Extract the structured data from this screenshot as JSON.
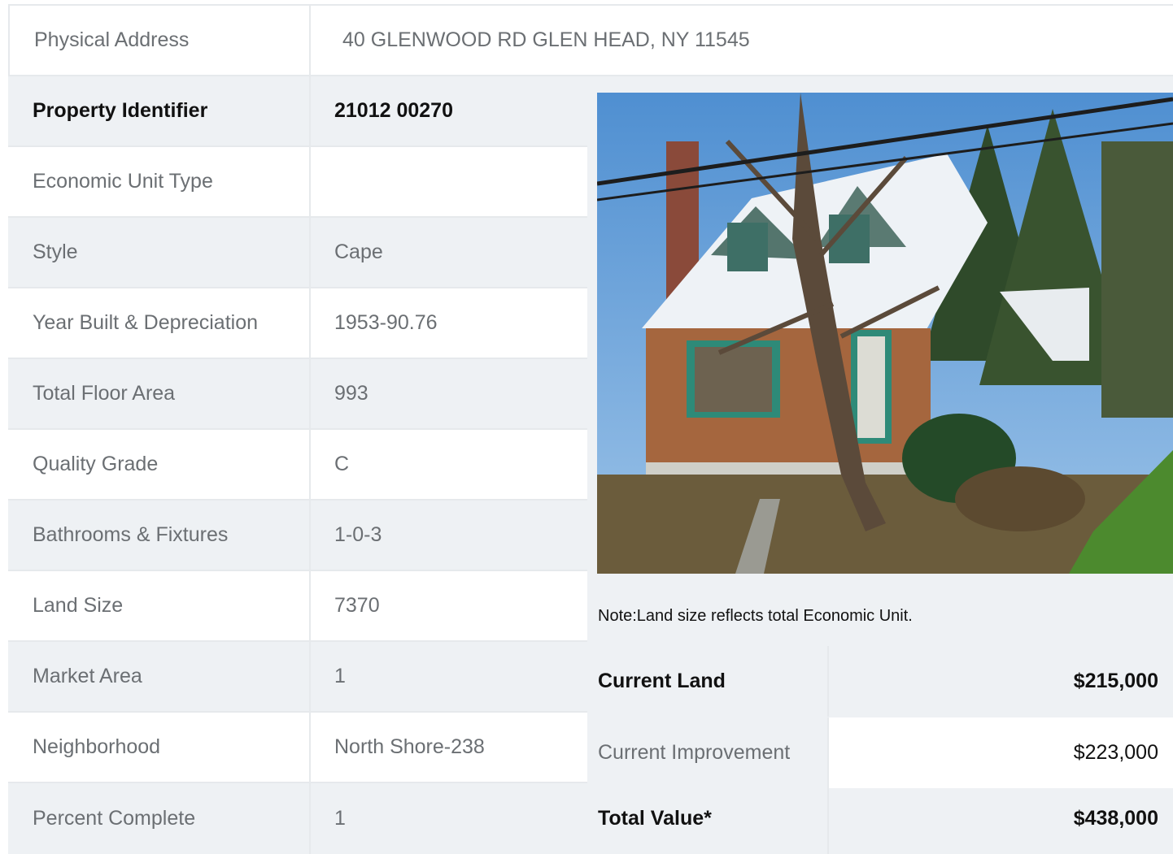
{
  "address": {
    "label": "Physical Address",
    "value": "40  GLENWOOD RD  GLEN HEAD, NY  11545"
  },
  "rows": [
    {
      "label": "Property Identifier",
      "value": "21012  00270"
    },
    {
      "label": "Economic Unit Type",
      "value": ""
    },
    {
      "label": "Style",
      "value": "Cape"
    },
    {
      "label": "Year Built & Depreciation",
      "value": "1953-90.76"
    },
    {
      "label": "Total Floor Area",
      "value": "993"
    },
    {
      "label": "Quality Grade",
      "value": "C"
    },
    {
      "label": "Bathrooms & Fixtures",
      "value": "1-0-3"
    },
    {
      "label": "Land Size",
      "value": "7370"
    },
    {
      "label": "Market Area",
      "value": "1"
    },
    {
      "label": "Neighborhood",
      "value": "North Shore-238"
    },
    {
      "label": "Percent Complete",
      "value": "1"
    }
  ],
  "note": "Note:Land size reflects total Economic Unit.",
  "values": [
    {
      "label": "Current Land",
      "value": "$215,000"
    },
    {
      "label": "Current Improvement",
      "value": "$223,000"
    },
    {
      "label": "Total Value*",
      "value": "$438,000"
    }
  ],
  "colors": {
    "shade": "#eef1f4",
    "border": "#e6e9ec",
    "text": "#6b6f73",
    "strong": "#111111"
  }
}
